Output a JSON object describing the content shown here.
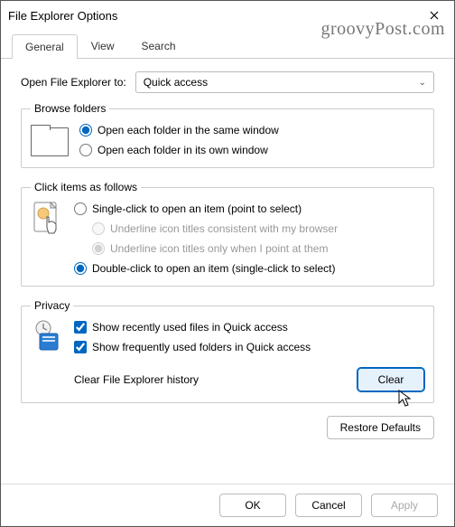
{
  "window": {
    "title": "File Explorer Options"
  },
  "watermark": "groovyPost.com",
  "tabs": {
    "general": "General",
    "view": "View",
    "search": "Search"
  },
  "open": {
    "label": "Open File Explorer to:",
    "value": "Quick access"
  },
  "browse": {
    "legend": "Browse folders",
    "same": "Open each folder in the same window",
    "own": "Open each folder in its own window"
  },
  "click": {
    "legend": "Click items as follows",
    "single": "Single-click to open an item (point to select)",
    "underline_browser": "Underline icon titles consistent with my browser",
    "underline_point": "Underline icon titles only when I point at them",
    "double": "Double-click to open an item (single-click to select)"
  },
  "privacy": {
    "legend": "Privacy",
    "recent": "Show recently used files in Quick access",
    "frequent": "Show frequently used folders in Quick access",
    "clear_label": "Clear File Explorer history",
    "clear_btn": "Clear"
  },
  "restore": "Restore Defaults",
  "footer": {
    "ok": "OK",
    "cancel": "Cancel",
    "apply": "Apply"
  }
}
